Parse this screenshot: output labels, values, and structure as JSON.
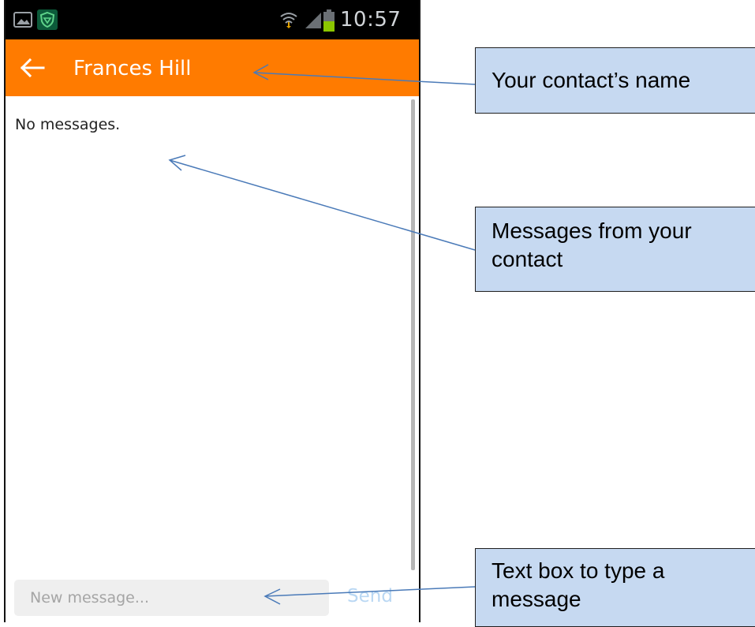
{
  "status_bar": {
    "time": "10:57",
    "icons": [
      "gallery-icon",
      "shield-icon",
      "wifi-icon",
      "signal-icon",
      "battery-icon"
    ],
    "colors": {
      "battery": "#8bc600",
      "background": "#000000"
    }
  },
  "header": {
    "back_icon": "arrow-left-icon",
    "contact_name": "Frances Hill",
    "color": "#ff7b00"
  },
  "messages": {
    "empty_text": "No messages."
  },
  "compose": {
    "placeholder": "New message...",
    "value": "",
    "send_label": "Send"
  },
  "annotations": {
    "contact_name": "Your contact’s name",
    "messages": "Messages from your contact",
    "text_box": "Text box to type a message",
    "box_color": "#c6d9f1",
    "arrow_color": "#4a7ab8"
  }
}
